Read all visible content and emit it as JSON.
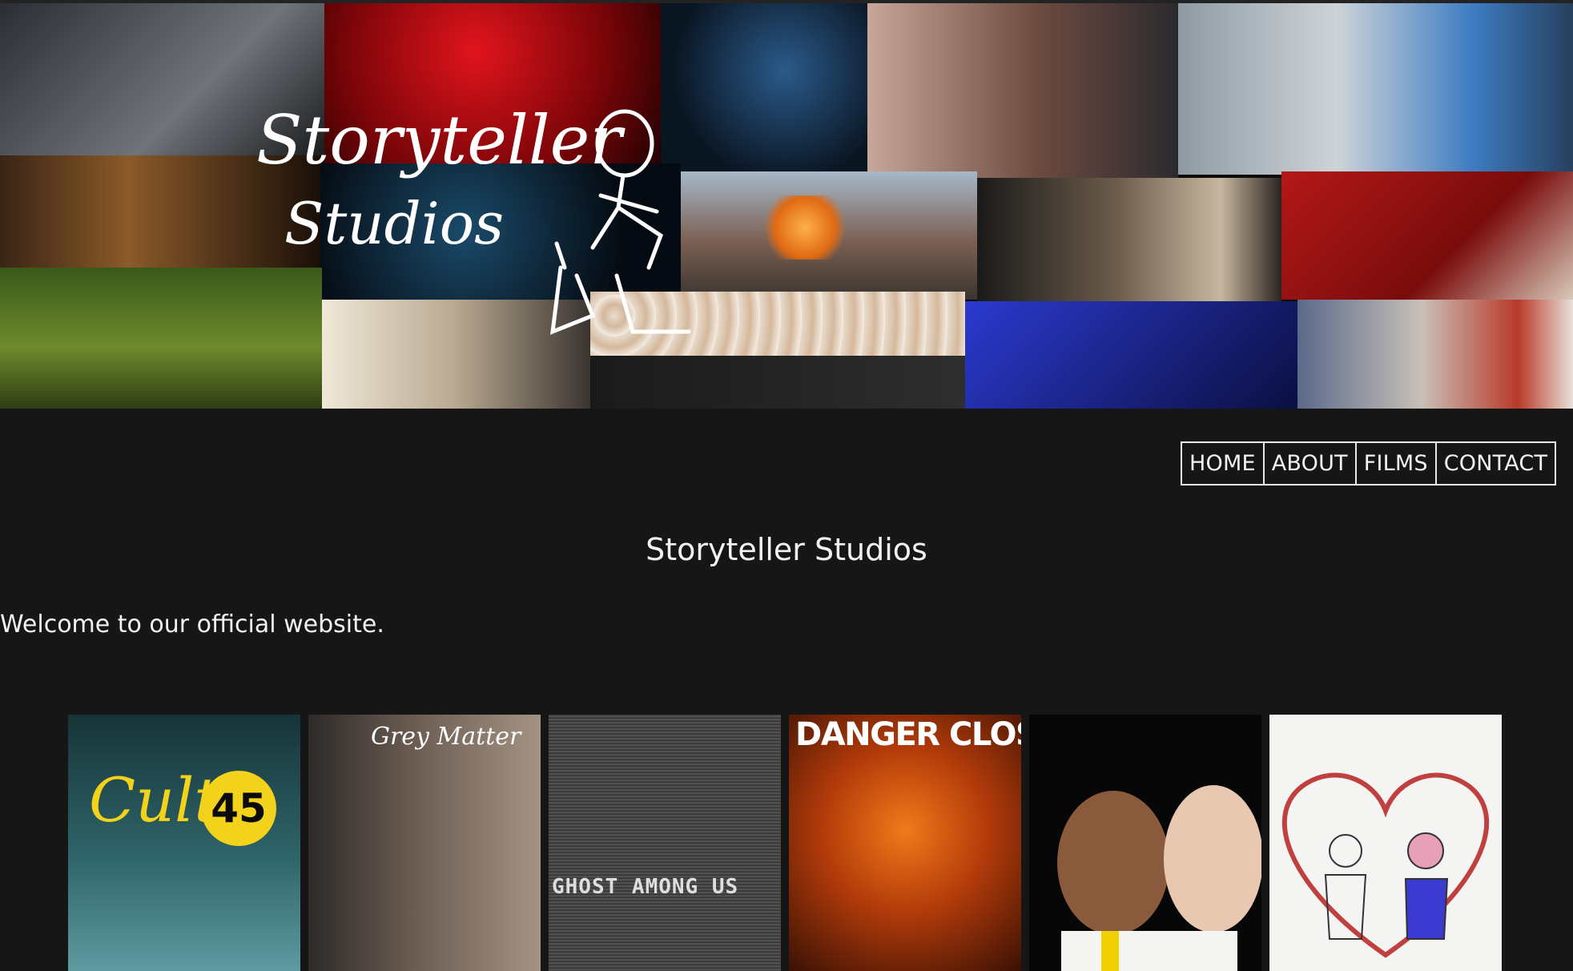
{
  "header": {
    "logo_line1": "Storyteller",
    "logo_line2": "Studios"
  },
  "nav": {
    "items": [
      {
        "label": "HOME"
      },
      {
        "label": "ABOUT"
      },
      {
        "label": "FILMS"
      },
      {
        "label": "CONTACT"
      }
    ]
  },
  "main": {
    "title": "Storyteller Studios",
    "welcome": "Welcome to our official website."
  },
  "posters": [
    {
      "title": "Cult",
      "badge": "45"
    },
    {
      "title": "Grey Matter"
    },
    {
      "title": "GHOST AMONG US"
    },
    {
      "title": "DANGER CLOSE"
    },
    {
      "title": ""
    },
    {
      "title": ""
    }
  ]
}
